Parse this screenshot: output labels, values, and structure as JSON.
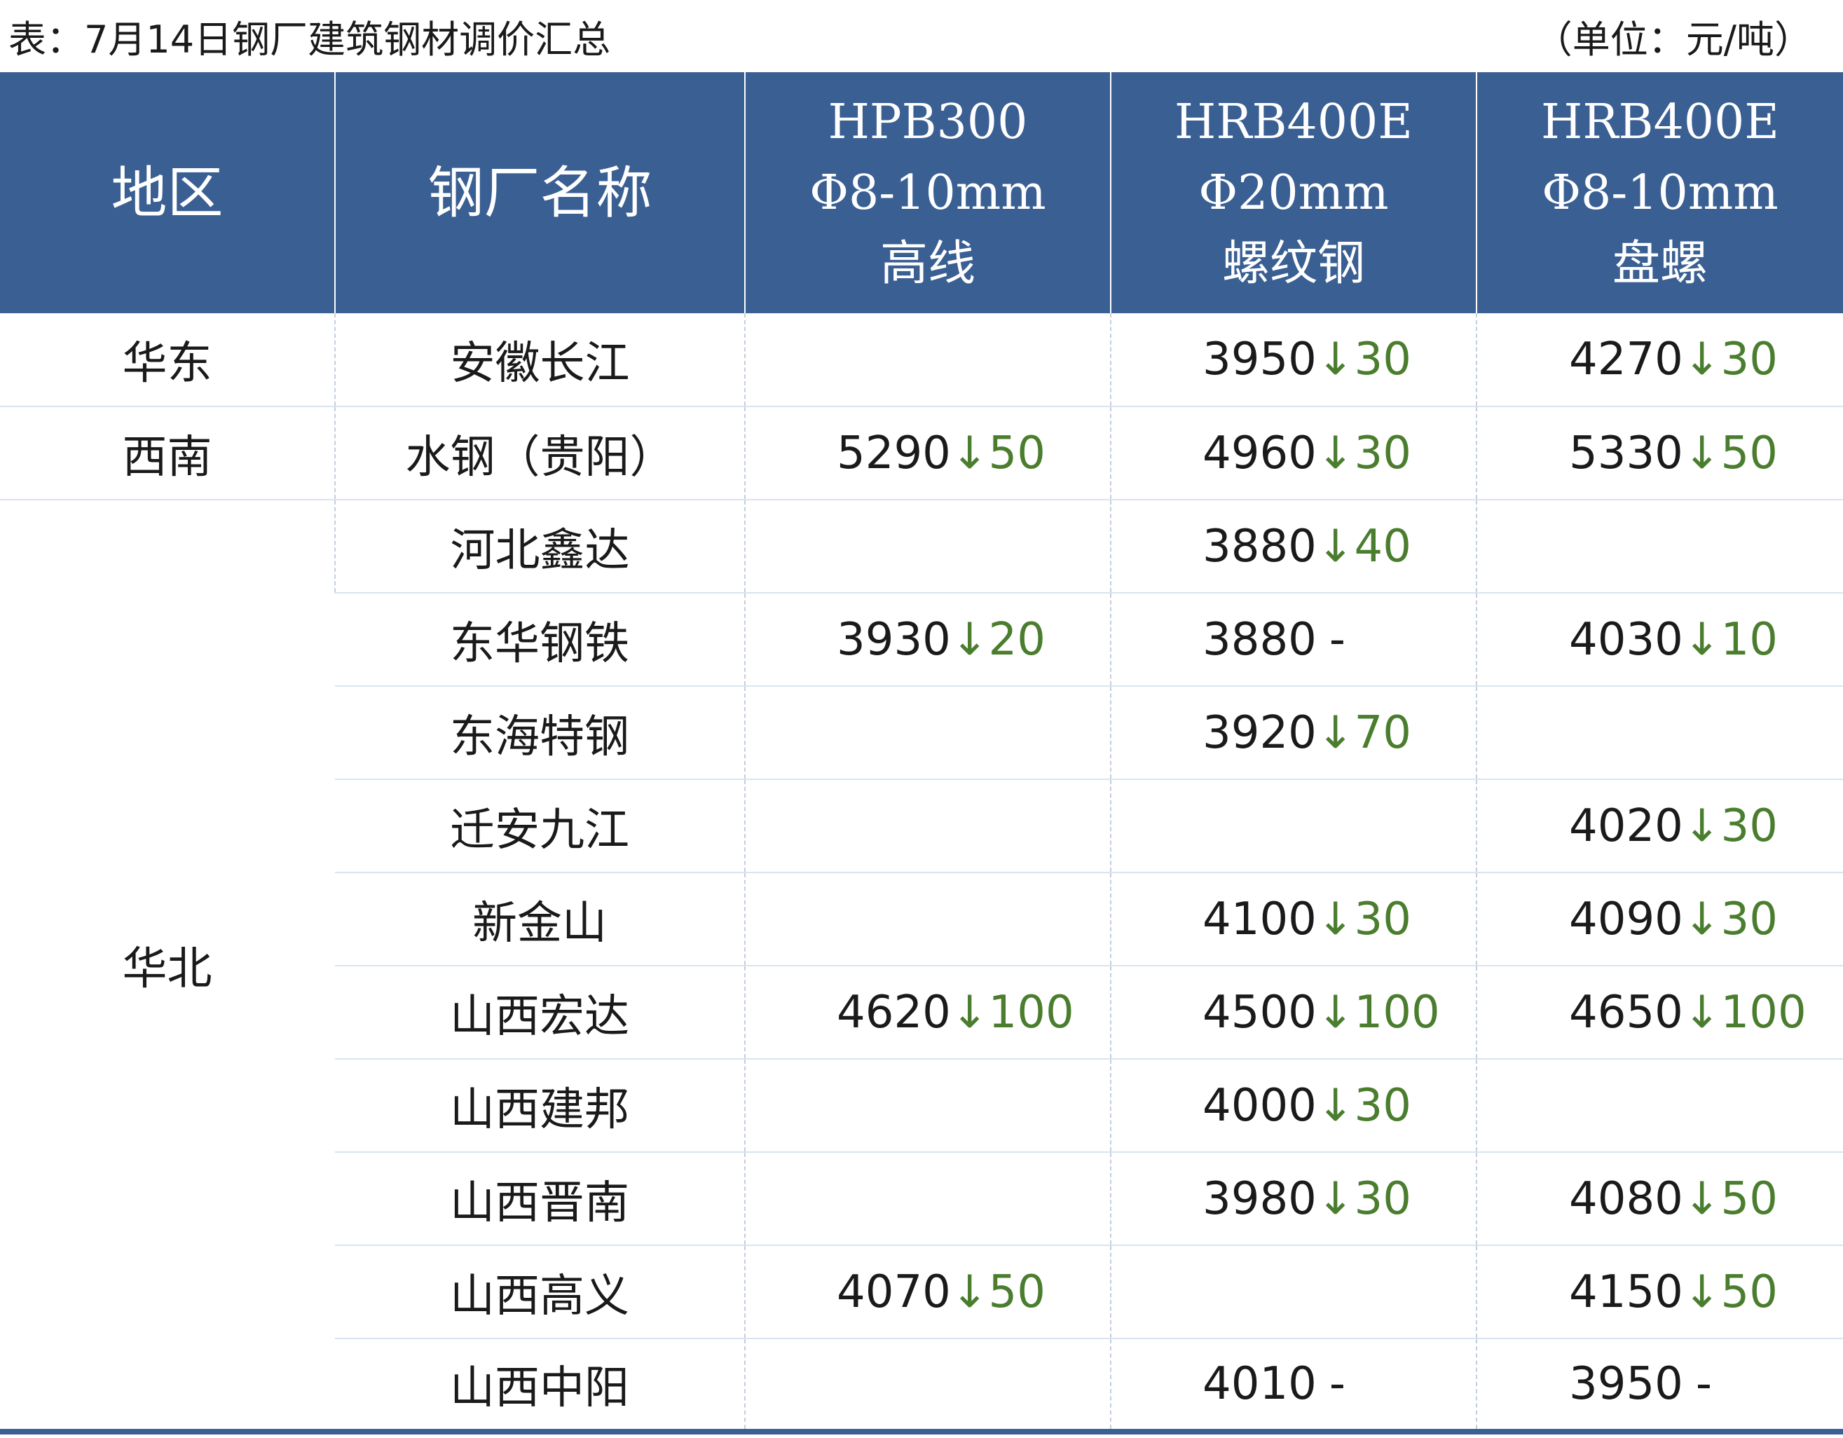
{
  "header": {
    "title": "表：7月14日钢厂建筑钢材调价汇总",
    "unit": "（单位：元/吨）"
  },
  "columns": [
    {
      "lines": [
        "地区"
      ]
    },
    {
      "lines": [
        "钢厂名称"
      ]
    },
    {
      "lines": [
        "HPB300",
        "Φ8-10mm",
        "高线"
      ]
    },
    {
      "lines": [
        "HRB400E",
        "Φ20mm",
        "螺纹钢"
      ]
    },
    {
      "lines": [
        "HRB400E",
        "Φ8-10mm",
        "盘螺"
      ]
    }
  ],
  "colors": {
    "header_bg": "#3a5f93",
    "decrease": "#4a7d2e"
  },
  "rows": [
    {
      "region": "华东",
      "mill": "安徽长江",
      "cells": [
        null,
        {
          "price": "3950",
          "arrow": "↓",
          "change": "30"
        },
        {
          "price": "4270",
          "arrow": "↓",
          "change": "30"
        }
      ]
    },
    {
      "region": "西南",
      "mill": "水钢（贵阳）",
      "cells": [
        {
          "price": "5290",
          "arrow": "↓",
          "change": "50"
        },
        {
          "price": "4960",
          "arrow": "↓",
          "change": "30"
        },
        {
          "price": "5330",
          "arrow": "↓",
          "change": "50"
        }
      ]
    },
    {
      "region": "华北",
      "mill": "河北鑫达",
      "cells": [
        null,
        {
          "price": "3880",
          "arrow": "↓",
          "change": "40"
        },
        null
      ]
    },
    {
      "region": "",
      "mill": "东华钢铁",
      "cells": [
        {
          "price": "3930",
          "arrow": "↓",
          "change": "20"
        },
        {
          "price": "3880",
          "arrow": "",
          "change": "-"
        },
        {
          "price": "4030",
          "arrow": "↓",
          "change": "10"
        }
      ]
    },
    {
      "region": "",
      "mill": "东海特钢",
      "cells": [
        null,
        {
          "price": "3920",
          "arrow": "↓",
          "change": "70"
        },
        null
      ]
    },
    {
      "region": "",
      "mill": "迁安九江",
      "cells": [
        null,
        null,
        {
          "price": "4020",
          "arrow": "↓",
          "change": "30"
        }
      ]
    },
    {
      "region": "",
      "mill": "新金山",
      "cells": [
        null,
        {
          "price": "4100",
          "arrow": "↓",
          "change": "30"
        },
        {
          "price": "4090",
          "arrow": "↓",
          "change": "30"
        }
      ]
    },
    {
      "region": "",
      "mill": "山西宏达",
      "cells": [
        {
          "price": "4620",
          "arrow": "↓",
          "change": "100"
        },
        {
          "price": "4500",
          "arrow": "↓",
          "change": "100"
        },
        {
          "price": "4650",
          "arrow": "↓",
          "change": "100"
        }
      ]
    },
    {
      "region": "",
      "mill": "山西建邦",
      "cells": [
        null,
        {
          "price": "4000",
          "arrow": "↓",
          "change": "30"
        },
        null
      ]
    },
    {
      "region": "",
      "mill": "山西晋南",
      "cells": [
        null,
        {
          "price": "3980",
          "arrow": "↓",
          "change": "30"
        },
        {
          "price": "4080",
          "arrow": "↓",
          "change": "50"
        }
      ]
    },
    {
      "region": "",
      "mill": "山西高义",
      "cells": [
        {
          "price": "4070",
          "arrow": "↓",
          "change": "50"
        },
        null,
        {
          "price": "4150",
          "arrow": "↓",
          "change": "50"
        }
      ]
    },
    {
      "region": "",
      "mill": "山西中阳",
      "cells": [
        null,
        {
          "price": "4010",
          "arrow": "",
          "change": "-"
        },
        {
          "price": "3950",
          "arrow": "",
          "change": "-"
        }
      ]
    }
  ]
}
